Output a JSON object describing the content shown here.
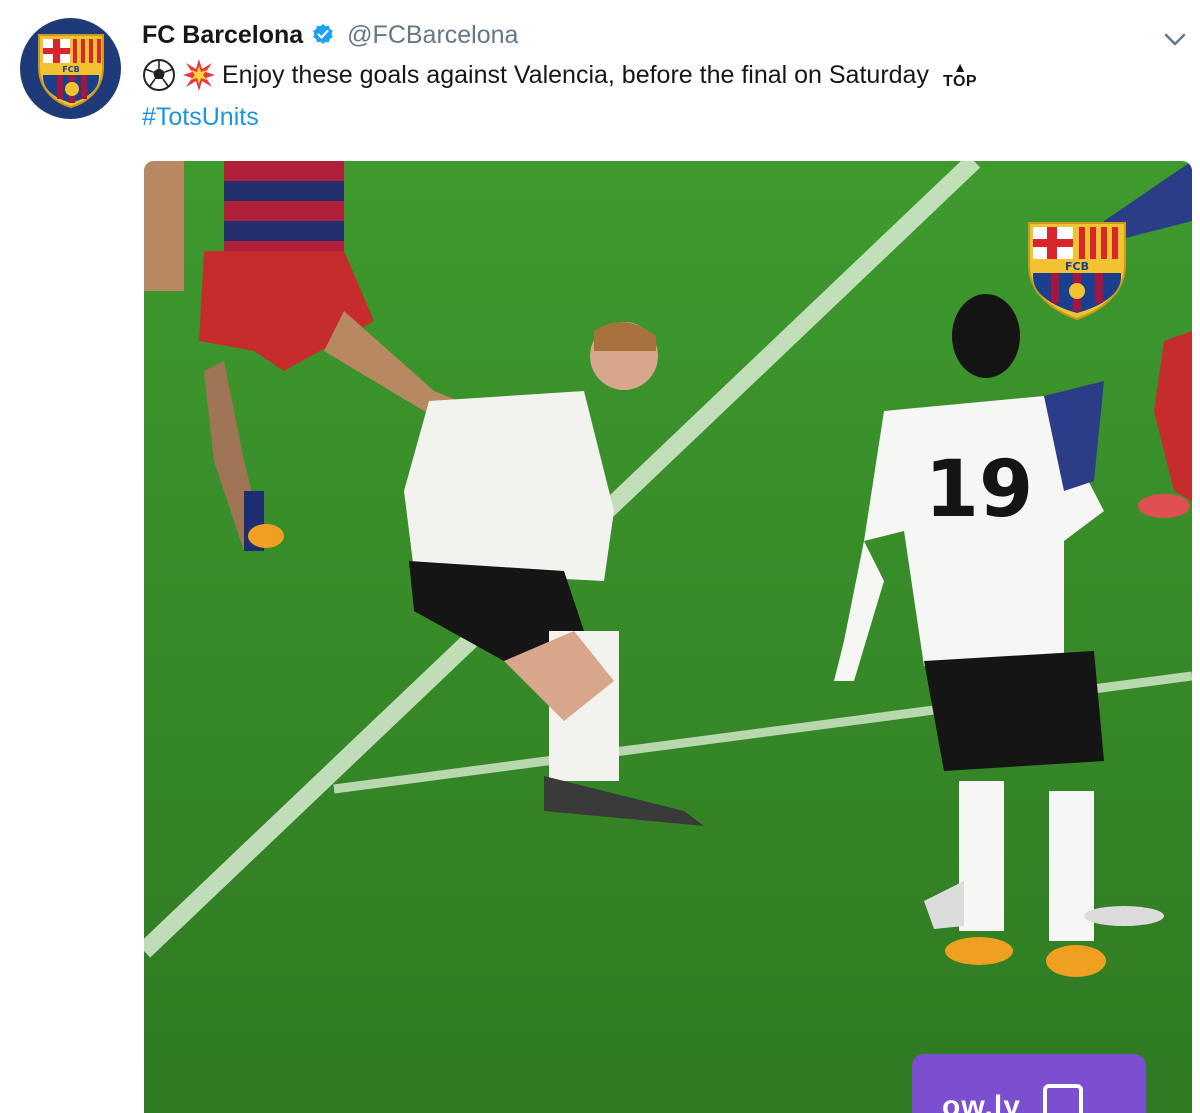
{
  "tweet": {
    "author_name": "FC Barcelona",
    "author_handle": "@FCBarcelona",
    "text": "Enjoy these goals against Valencia, before the final on Saturday",
    "hashtag": "#TotsUnits",
    "emoji_icons": [
      "soccer-ball-icon",
      "collision-icon",
      "top-arrow-icon"
    ],
    "top_label": "TOP"
  },
  "avatar": {
    "crest_text": "FCB",
    "background_color": "#1f3a78"
  },
  "media": {
    "watermark_crest_text": "FCB",
    "player_number": "19",
    "link_badge_label": "ow.ly",
    "pitch_color": "#3e8f2c"
  },
  "colors": {
    "hashtag": "#1b95e0",
    "verified": "#1da1f2",
    "handle": "#657786",
    "badge": "#7b4fd0"
  }
}
